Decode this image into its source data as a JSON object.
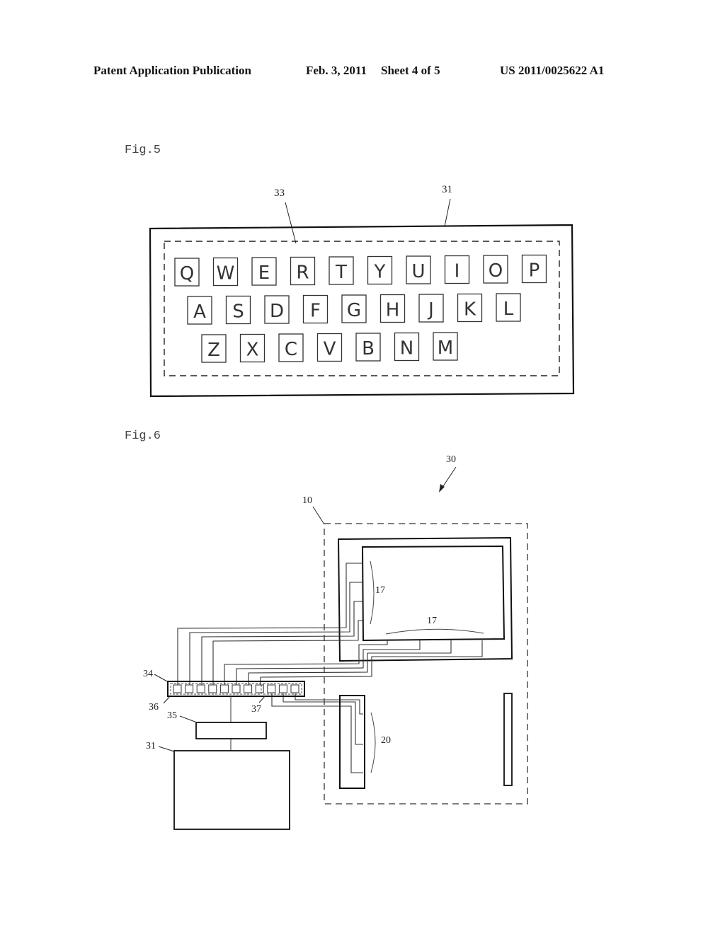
{
  "header": {
    "publication": "Patent Application Publication",
    "date": "Feb. 3, 2011",
    "sheet": "Sheet 4 of 5",
    "number": "US 2011/0025622 A1"
  },
  "fig5": {
    "label": "Fig.5",
    "refs": {
      "keyboard_area": "33",
      "display": "31"
    },
    "keyboard_rows": [
      [
        "Q",
        "W",
        "E",
        "R",
        "T",
        "Y",
        "U",
        "I",
        "O",
        "P"
      ],
      [
        "A",
        "S",
        "D",
        "F",
        "G",
        "H",
        "J",
        "K",
        "L"
      ],
      [
        "Z",
        "X",
        "C",
        "V",
        "B",
        "N",
        "M"
      ]
    ]
  },
  "fig6": {
    "label": "Fig.6",
    "refs": {
      "system": "30",
      "panel": "10",
      "electrodes_side": "17",
      "electrodes_bottom": "17",
      "sensor": "20",
      "connector": "34",
      "controller": "35",
      "display": "31",
      "terminal_group_a": "36",
      "terminal_group_b": "37"
    },
    "connector_terminal_count": 11
  }
}
